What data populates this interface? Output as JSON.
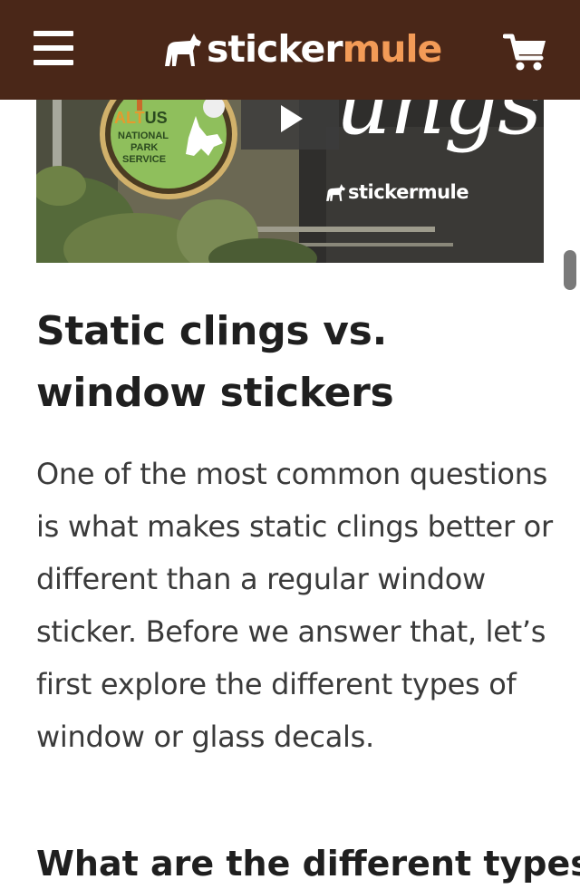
{
  "header": {
    "logo_part1": "sticker",
    "logo_part2": "mule",
    "brand_colors": {
      "bar": "#4a2718",
      "accent": "#f39b57"
    },
    "icons": [
      "menu-icon",
      "mule-logo-icon",
      "cart-icon"
    ]
  },
  "video": {
    "script_word": "ungs",
    "brand_part1": "sticker",
    "brand_part2": "mule",
    "badge": {
      "alt": "ALT",
      "us": "US",
      "line1": "NATIONAL",
      "line2": "PARK",
      "line3": "SERVICE"
    },
    "icons": [
      "play-icon"
    ]
  },
  "article": {
    "title": "Static clings vs. window stickers",
    "paragraph": "One of the most common questions is what makes static clings better or different than a regular window sticker. Before we answer that, let’s first explore the different types of window or glass decals.",
    "next_heading": "What are the different types of"
  }
}
